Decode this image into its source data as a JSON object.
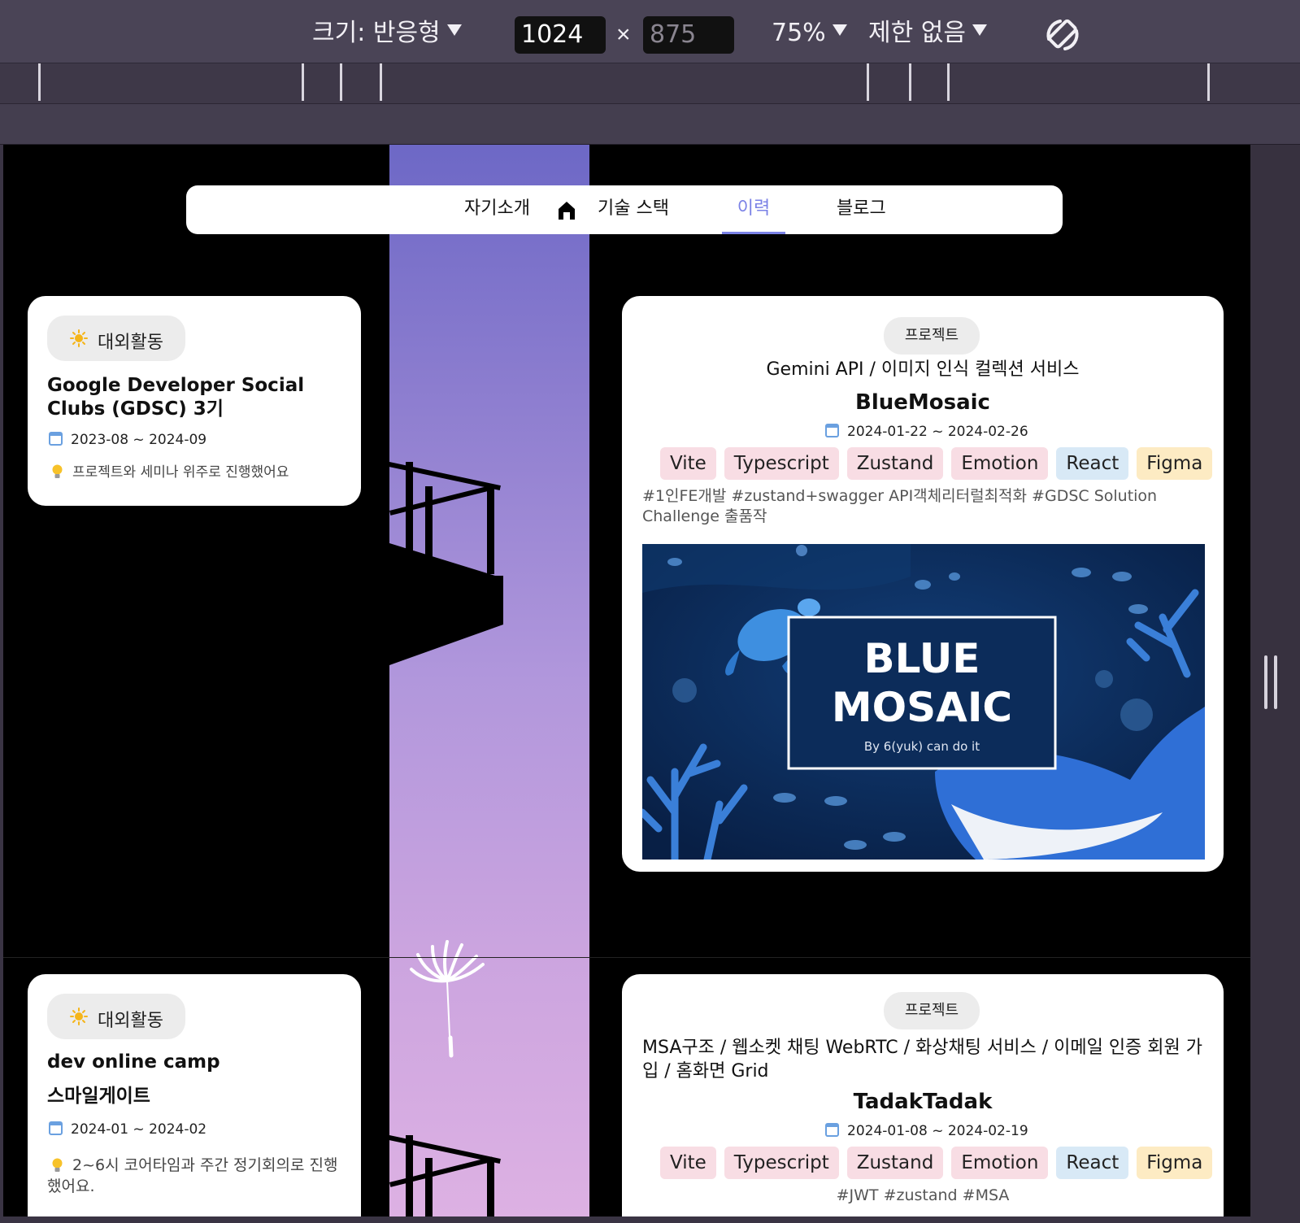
{
  "toolbar": {
    "size_label": "크기: 반응형",
    "width_value": "1024",
    "times": "×",
    "height_value": "875",
    "zoom": "75%",
    "throttle": "제한 없음"
  },
  "nav": {
    "items": [
      {
        "label": "자기소개"
      },
      {
        "label": "기술 스택"
      },
      {
        "label": "이력"
      },
      {
        "label": "블로그"
      }
    ],
    "active": "이력"
  },
  "activities": [
    {
      "chip": "대외활동",
      "title": "Google Developer Social Clubs (GDSC) 3기",
      "date": "2023-08 ~ 2024-09",
      "note": "프로젝트와 세미나 위주로 진행했어요"
    },
    {
      "chip": "대외활동",
      "title_line1": "dev online camp",
      "title_line2": "스마일게이트",
      "date": "2024-01 ~ 2024-02",
      "note": "2~6시 코어타임과 주간 정기회의로 진행했어요."
    }
  ],
  "projects": [
    {
      "chip": "프로젝트",
      "subtitle": "Gemini API / 이미지 인식 컬렉션 서비스",
      "name": "BlueMosaic",
      "date": "2024-01-22 ~ 2024-02-26",
      "tags": [
        {
          "label": "Vite",
          "color": "#f8dde4"
        },
        {
          "label": "Typescript",
          "color": "#f8dde4"
        },
        {
          "label": "Zustand",
          "color": "#f8dde4"
        },
        {
          "label": "Emotion",
          "color": "#f8dde4"
        },
        {
          "label": "React",
          "color": "#d8e9f6"
        },
        {
          "label": "Figma",
          "color": "#fdebc3"
        }
      ],
      "hashtags": "#1인FE개발 #zustand+swagger API객체리터럴최적화 #GDSC Solution Challenge 출품작",
      "banner": {
        "line1": "BLUE",
        "line2": "MOSAIC",
        "by": "By  6(yuk) can do it"
      }
    },
    {
      "chip": "프로젝트",
      "subtitle": "MSA구조 / 웹소켓 채팅 WebRTC / 화상채팅 서비스 / 이메일 인증 회원 가입 / 홈화면 Grid",
      "name": "TadakTadak",
      "date": "2024-01-08 ~ 2024-02-19",
      "tags": [
        {
          "label": "Vite",
          "color": "#f8dde4"
        },
        {
          "label": "Typescript",
          "color": "#f8dde4"
        },
        {
          "label": "Zustand",
          "color": "#f8dde4"
        },
        {
          "label": "Emotion",
          "color": "#f8dde4"
        },
        {
          "label": "React",
          "color": "#d8e9f6"
        },
        {
          "label": "Figma",
          "color": "#fdebc3"
        }
      ],
      "hashtags": "#JWT #zustand #MSA"
    }
  ],
  "colors": {
    "accent": "#7b82e6",
    "sky_top": "#6d68c6",
    "sky_bottom": "#ddb1e3"
  }
}
